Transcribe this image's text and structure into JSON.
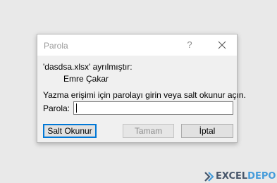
{
  "dialog": {
    "title": "Parola",
    "help_glyph": "?",
    "file_line": "'dasdsa.xlsx' ayrılmıştır:",
    "owner_name": "Emre Çakar",
    "instruction": "Yazma erişimi için parolayı girin veya salt okunur açın.",
    "password_label": "Parola:",
    "password_value": "",
    "buttons": {
      "read_only": "Salt Okunur",
      "ok": "Tamam",
      "cancel": "İptal"
    }
  },
  "watermark": {
    "brand_part1": "EXCEL",
    "brand_part2": "DEPO"
  },
  "icons": {
    "close": "close-icon",
    "logo": "excel-depo-logo-icon"
  },
  "colors": {
    "default_button_border": "#0078d7",
    "dialog_bg": "#f0f0f0",
    "titlebar_bg": "#ffffff"
  }
}
